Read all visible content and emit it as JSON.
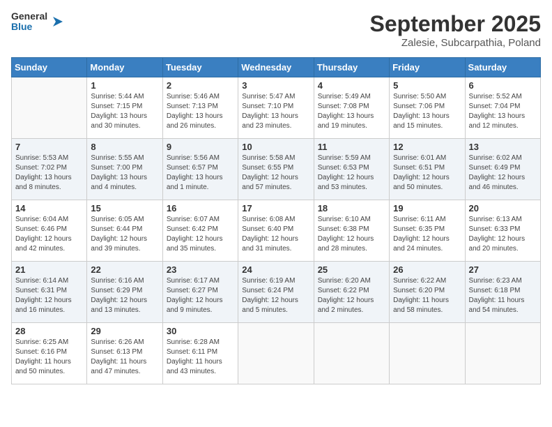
{
  "header": {
    "logo": {
      "general": "General",
      "blue": "Blue"
    },
    "title": "September 2025",
    "subtitle": "Zalesie, Subcarpathia, Poland"
  },
  "weekdays": [
    "Sunday",
    "Monday",
    "Tuesday",
    "Wednesday",
    "Thursday",
    "Friday",
    "Saturday"
  ],
  "weeks": [
    [
      {
        "day": "",
        "detail": ""
      },
      {
        "day": "1",
        "detail": "Sunrise: 5:44 AM\nSunset: 7:15 PM\nDaylight: 13 hours\nand 30 minutes."
      },
      {
        "day": "2",
        "detail": "Sunrise: 5:46 AM\nSunset: 7:13 PM\nDaylight: 13 hours\nand 26 minutes."
      },
      {
        "day": "3",
        "detail": "Sunrise: 5:47 AM\nSunset: 7:10 PM\nDaylight: 13 hours\nand 23 minutes."
      },
      {
        "day": "4",
        "detail": "Sunrise: 5:49 AM\nSunset: 7:08 PM\nDaylight: 13 hours\nand 19 minutes."
      },
      {
        "day": "5",
        "detail": "Sunrise: 5:50 AM\nSunset: 7:06 PM\nDaylight: 13 hours\nand 15 minutes."
      },
      {
        "day": "6",
        "detail": "Sunrise: 5:52 AM\nSunset: 7:04 PM\nDaylight: 13 hours\nand 12 minutes."
      }
    ],
    [
      {
        "day": "7",
        "detail": "Sunrise: 5:53 AM\nSunset: 7:02 PM\nDaylight: 13 hours\nand 8 minutes."
      },
      {
        "day": "8",
        "detail": "Sunrise: 5:55 AM\nSunset: 7:00 PM\nDaylight: 13 hours\nand 4 minutes."
      },
      {
        "day": "9",
        "detail": "Sunrise: 5:56 AM\nSunset: 6:57 PM\nDaylight: 13 hours\nand 1 minute."
      },
      {
        "day": "10",
        "detail": "Sunrise: 5:58 AM\nSunset: 6:55 PM\nDaylight: 12 hours\nand 57 minutes."
      },
      {
        "day": "11",
        "detail": "Sunrise: 5:59 AM\nSunset: 6:53 PM\nDaylight: 12 hours\nand 53 minutes."
      },
      {
        "day": "12",
        "detail": "Sunrise: 6:01 AM\nSunset: 6:51 PM\nDaylight: 12 hours\nand 50 minutes."
      },
      {
        "day": "13",
        "detail": "Sunrise: 6:02 AM\nSunset: 6:49 PM\nDaylight: 12 hours\nand 46 minutes."
      }
    ],
    [
      {
        "day": "14",
        "detail": "Sunrise: 6:04 AM\nSunset: 6:46 PM\nDaylight: 12 hours\nand 42 minutes."
      },
      {
        "day": "15",
        "detail": "Sunrise: 6:05 AM\nSunset: 6:44 PM\nDaylight: 12 hours\nand 39 minutes."
      },
      {
        "day": "16",
        "detail": "Sunrise: 6:07 AM\nSunset: 6:42 PM\nDaylight: 12 hours\nand 35 minutes."
      },
      {
        "day": "17",
        "detail": "Sunrise: 6:08 AM\nSunset: 6:40 PM\nDaylight: 12 hours\nand 31 minutes."
      },
      {
        "day": "18",
        "detail": "Sunrise: 6:10 AM\nSunset: 6:38 PM\nDaylight: 12 hours\nand 28 minutes."
      },
      {
        "day": "19",
        "detail": "Sunrise: 6:11 AM\nSunset: 6:35 PM\nDaylight: 12 hours\nand 24 minutes."
      },
      {
        "day": "20",
        "detail": "Sunrise: 6:13 AM\nSunset: 6:33 PM\nDaylight: 12 hours\nand 20 minutes."
      }
    ],
    [
      {
        "day": "21",
        "detail": "Sunrise: 6:14 AM\nSunset: 6:31 PM\nDaylight: 12 hours\nand 16 minutes."
      },
      {
        "day": "22",
        "detail": "Sunrise: 6:16 AM\nSunset: 6:29 PM\nDaylight: 12 hours\nand 13 minutes."
      },
      {
        "day": "23",
        "detail": "Sunrise: 6:17 AM\nSunset: 6:27 PM\nDaylight: 12 hours\nand 9 minutes."
      },
      {
        "day": "24",
        "detail": "Sunrise: 6:19 AM\nSunset: 6:24 PM\nDaylight: 12 hours\nand 5 minutes."
      },
      {
        "day": "25",
        "detail": "Sunrise: 6:20 AM\nSunset: 6:22 PM\nDaylight: 12 hours\nand 2 minutes."
      },
      {
        "day": "26",
        "detail": "Sunrise: 6:22 AM\nSunset: 6:20 PM\nDaylight: 11 hours\nand 58 minutes."
      },
      {
        "day": "27",
        "detail": "Sunrise: 6:23 AM\nSunset: 6:18 PM\nDaylight: 11 hours\nand 54 minutes."
      }
    ],
    [
      {
        "day": "28",
        "detail": "Sunrise: 6:25 AM\nSunset: 6:16 PM\nDaylight: 11 hours\nand 50 minutes."
      },
      {
        "day": "29",
        "detail": "Sunrise: 6:26 AM\nSunset: 6:13 PM\nDaylight: 11 hours\nand 47 minutes."
      },
      {
        "day": "30",
        "detail": "Sunrise: 6:28 AM\nSunset: 6:11 PM\nDaylight: 11 hours\nand 43 minutes."
      },
      {
        "day": "",
        "detail": ""
      },
      {
        "day": "",
        "detail": ""
      },
      {
        "day": "",
        "detail": ""
      },
      {
        "day": "",
        "detail": ""
      }
    ]
  ]
}
